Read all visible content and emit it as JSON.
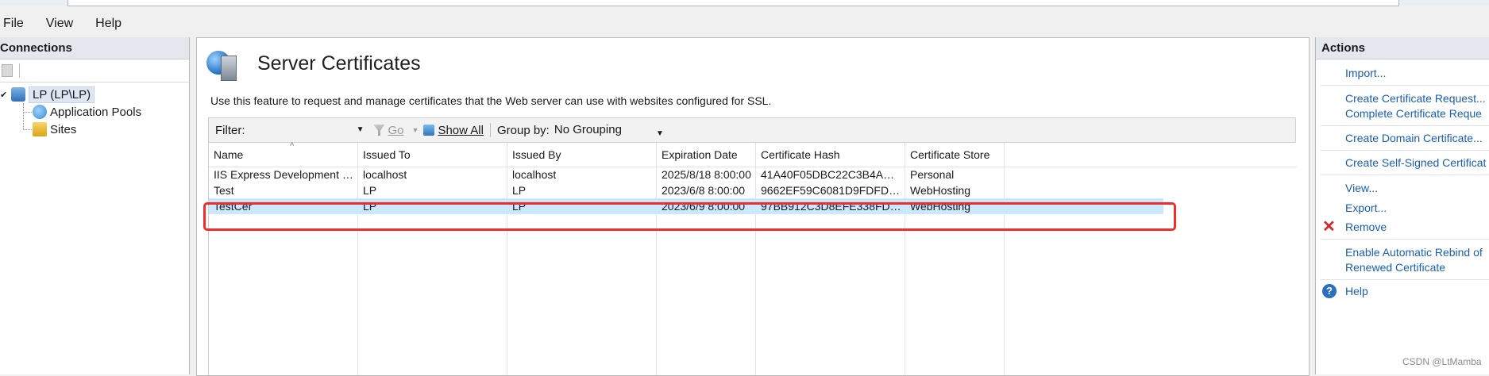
{
  "menu": {
    "file": "File",
    "view": "View",
    "help": "Help"
  },
  "connections": {
    "title": "Connections",
    "tree": {
      "root": "LP (LP\\LP)",
      "children": [
        "Application Pools",
        "Sites"
      ]
    }
  },
  "main": {
    "title": "Server Certificates",
    "description": "Use this feature to request and manage certificates that the Web server can use with websites configured for SSL.",
    "filter_label": "Filter:",
    "go_label": "Go",
    "show_all_label": "Show All",
    "group_by_label": "Group by:",
    "group_by_value": "No Grouping",
    "columns": [
      "Name",
      "Issued To",
      "Issued By",
      "Expiration Date",
      "Certificate Hash",
      "Certificate Store"
    ],
    "rows": [
      [
        "IIS Express Development Certif...",
        "localhost",
        "localhost",
        "2025/8/18 8:00:00",
        "41A40F05DBC22C3B4ADACE...",
        "Personal"
      ],
      [
        "Test",
        "LP",
        "LP",
        "2023/6/8 8:00:00",
        "9662EF59C6081D9FDFDFBC9A...",
        "WebHosting"
      ],
      [
        "TestCer",
        "LP",
        "LP",
        "2023/6/9 8:00:00",
        "97BB912C3D8EFE338FDC8CE...",
        "WebHosting"
      ]
    ],
    "selected_row": 2
  },
  "actions": {
    "title": "Actions",
    "import": "Import...",
    "create_request": "Create Certificate Request...",
    "complete_request": "Complete Certificate Reque",
    "create_domain": "Create Domain Certificate...",
    "create_self_signed": "Create Self-Signed Certificat",
    "view": "View...",
    "export": "Export...",
    "remove": "Remove",
    "rebind_line1": "Enable Automatic Rebind of",
    "rebind_line2": "Renewed Certificate",
    "help": "Help"
  },
  "watermark": "CSDN @LtMamba",
  "colors": {
    "link": "#1a5fb4",
    "selection": "#cce8ff",
    "highlight_box": "#ef2d2d",
    "remove": "#d9232d"
  }
}
